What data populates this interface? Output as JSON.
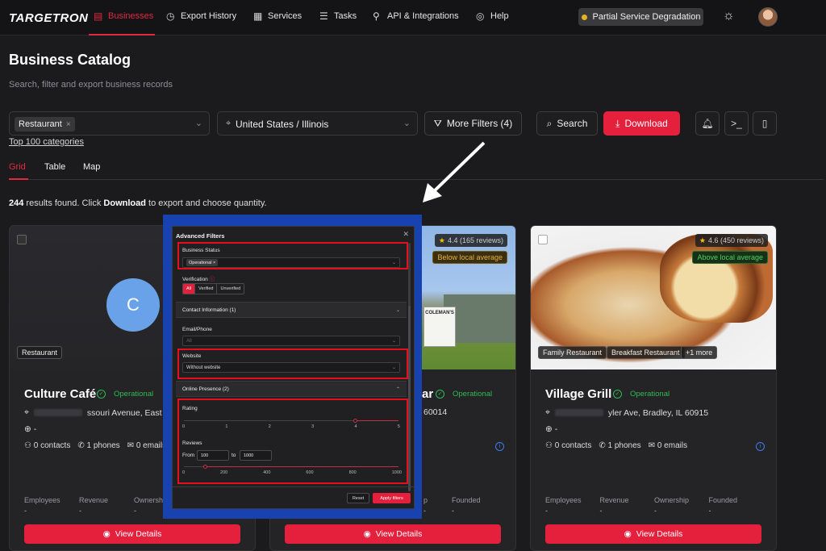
{
  "nav": {
    "logo": "TARGETRON",
    "items": [
      {
        "label": "Businesses",
        "icon": "building-icon"
      },
      {
        "label": "Export History",
        "icon": "clock-icon"
      },
      {
        "label": "Services",
        "icon": "grid-icon"
      },
      {
        "label": "Tasks",
        "icon": "tasks-icon"
      },
      {
        "label": "API & Integrations",
        "icon": "plug-icon"
      },
      {
        "label": "Help",
        "icon": "help-icon"
      }
    ],
    "status": "Partial Service Degradation",
    "status_color": "#e6b122"
  },
  "header": {
    "title": "Business Catalog",
    "subtitle": "Search, filter and export business records"
  },
  "filters": {
    "category_chip": "Restaurant",
    "location": "United States / Illinois",
    "more_filters": "More Filters (4)",
    "search": "Search",
    "download": "Download",
    "top_categories": "Top 100 categories"
  },
  "view_tabs": [
    "Grid",
    "Table",
    "Map"
  ],
  "results": {
    "count": "244",
    "pre": " results found. Click ",
    "bold": "Download",
    "post": " to export and choose quantity."
  },
  "cards": [
    {
      "name": "Culture Café",
      "status": "Operational",
      "address": "ssouri Avenue, East St Lo",
      "website": "-",
      "contacts": "0 contacts",
      "phones": "1 phones",
      "emails": "0 emails",
      "avatar_letter": "C",
      "tags": [
        "Restaurant"
      ],
      "meta": [
        {
          "k": "Employees",
          "v": "-"
        },
        {
          "k": "Revenue",
          "v": "-"
        },
        {
          "k": "Ownership",
          "v": "-"
        }
      ],
      "button": "View Details"
    },
    {
      "name": "ar",
      "status": "Operational",
      "address": "60014",
      "rating": "4.4 (165 reviews)",
      "local": "Below local average",
      "sign": "COLEMAN'S",
      "meta": [
        {
          "k": "p",
          "v": "-"
        },
        {
          "k": "Founded",
          "v": "-"
        }
      ],
      "button": "View Details"
    },
    {
      "name": "Village Grill",
      "status": "Operational",
      "address": "yler Ave, Bradley, IL 60915",
      "website": "-",
      "contacts": "0 contacts",
      "phones": "1 phones",
      "emails": "0 emails",
      "rating": "4.6 (450 reviews)",
      "local": "Above local average",
      "tags": [
        "Family Restaurant",
        "Breakfast Restaurant",
        "+1 more"
      ],
      "meta": [
        {
          "k": "Employees",
          "v": "-"
        },
        {
          "k": "Revenue",
          "v": "-"
        },
        {
          "k": "Ownership",
          "v": "-"
        },
        {
          "k": "Founded",
          "v": "-"
        }
      ],
      "button": "View Details"
    }
  ],
  "modal": {
    "title": "Advanced Filters",
    "business_status_label": "Business Status",
    "business_status_chip": "Operational",
    "verification_label": "Verification",
    "verification_options": [
      "All",
      "Verified",
      "Unverified"
    ],
    "contact_info": "Contact Information (1)",
    "email_phone_label": "Email/Phone",
    "email_phone_value": "All",
    "website_label": "Website",
    "website_value": "Without website",
    "online_presence": "Online Presence (2)",
    "rating_label": "Rating",
    "rating_ticks": [
      "0",
      "1",
      "2",
      "3",
      "4",
      "5"
    ],
    "rating_min": 4,
    "reviews_label": "Reviews",
    "from_label": "From",
    "to_label": "to",
    "reviews_from": "100",
    "reviews_to": "1000",
    "reviews_ticks": [
      "0",
      "200",
      "400",
      "600",
      "800",
      "1000"
    ],
    "reset": "Reset",
    "apply": "Apply filters"
  }
}
